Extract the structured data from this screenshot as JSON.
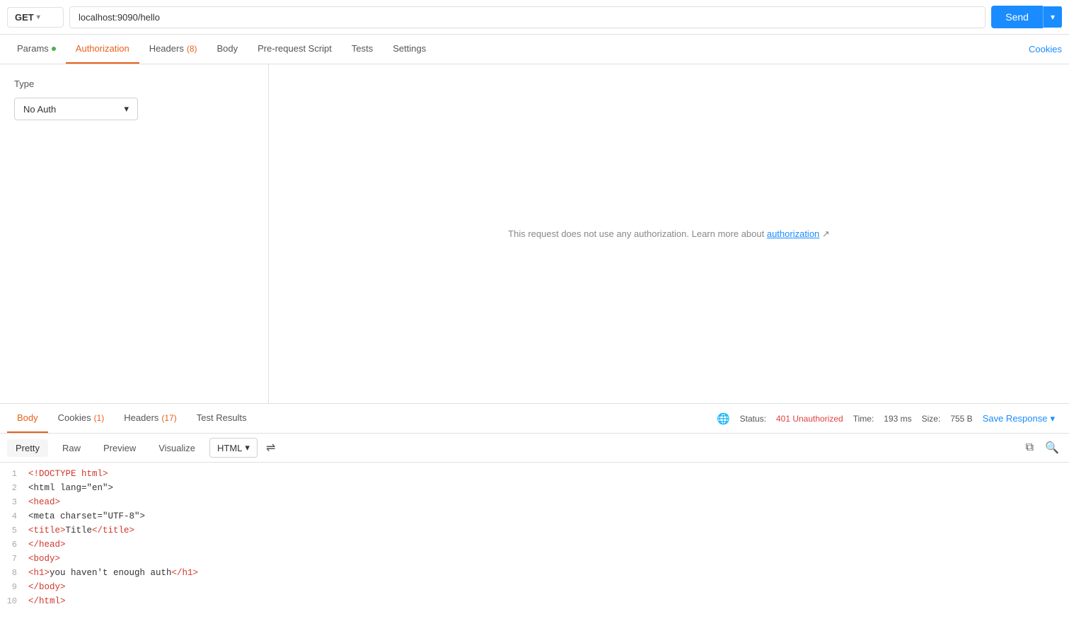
{
  "urlBar": {
    "method": "GET",
    "url": "localhost:9090/hello",
    "sendLabel": "Send"
  },
  "requestTabs": [
    {
      "id": "params",
      "label": "Params",
      "hasDot": true,
      "badge": null,
      "active": false
    },
    {
      "id": "authorization",
      "label": "Authorization",
      "hasDot": false,
      "badge": null,
      "active": true
    },
    {
      "id": "headers",
      "label": "Headers",
      "hasDot": false,
      "badge": "8",
      "active": false
    },
    {
      "id": "body",
      "label": "Body",
      "hasDot": false,
      "badge": null,
      "active": false
    },
    {
      "id": "prerequest",
      "label": "Pre-request Script",
      "hasDot": false,
      "badge": null,
      "active": false
    },
    {
      "id": "tests",
      "label": "Tests",
      "hasDot": false,
      "badge": null,
      "active": false
    },
    {
      "id": "settings",
      "label": "Settings",
      "hasDot": false,
      "badge": null,
      "active": false
    }
  ],
  "cookiesLink": "Cookies",
  "auth": {
    "typeLabel": "Type",
    "selectedType": "No Auth",
    "infoText": "This request does not use any authorization. Learn more about ",
    "authLink": "authorization",
    "authLinkArrow": " ↗"
  },
  "responseTabs": [
    {
      "id": "body",
      "label": "Body",
      "badge": null,
      "active": true
    },
    {
      "id": "cookies",
      "label": "Cookies",
      "badge": "1",
      "active": false
    },
    {
      "id": "headers",
      "label": "Headers",
      "badge": "17",
      "active": false
    },
    {
      "id": "testresults",
      "label": "Test Results",
      "badge": null,
      "active": false
    }
  ],
  "responseStatus": {
    "statusLabel": "Status:",
    "statusValue": "401 Unauthorized",
    "timeLabel": "Time:",
    "timeValue": "193 ms",
    "sizeLabel": "Size:",
    "sizeValue": "755 B",
    "saveResponse": "Save Response"
  },
  "codeViewer": {
    "formatTabs": [
      "Pretty",
      "Raw",
      "Preview",
      "Visualize"
    ],
    "activeFormat": "Pretty",
    "language": "HTML",
    "lines": [
      {
        "num": 1,
        "content": "<!DOCTYPE html>"
      },
      {
        "num": 2,
        "content": "<html lang=\"en\">"
      },
      {
        "num": 3,
        "content": "<head>"
      },
      {
        "num": 4,
        "content": "    <meta charset=\"UTF-8\">"
      },
      {
        "num": 5,
        "content": "    <title>Title</title>"
      },
      {
        "num": 6,
        "content": "</head>"
      },
      {
        "num": 7,
        "content": "<body>"
      },
      {
        "num": 8,
        "content": "<h1>you haven't enough auth</h1>"
      },
      {
        "num": 9,
        "content": "</body>"
      },
      {
        "num": 10,
        "content": "</html>"
      }
    ]
  }
}
